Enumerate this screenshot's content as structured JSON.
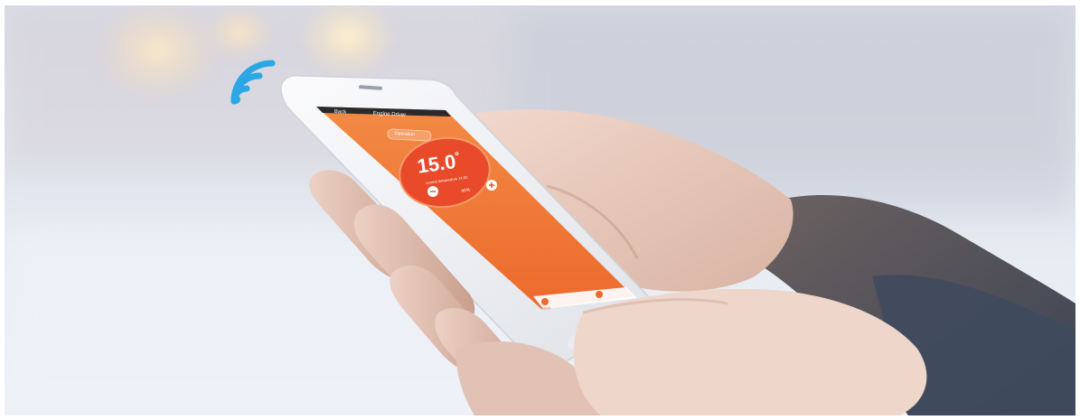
{
  "phone": {
    "app_header": {
      "back_label": "Back",
      "title": "Engine Driver"
    },
    "thermostat": {
      "mode_pill": "Operation",
      "temperature": "15.0",
      "degree_mark": "°",
      "sublabel": "current temperature 14.0C",
      "humidity": "40%"
    },
    "bottom_nav": {
      "left_label": "Heat",
      "right_label": ""
    }
  },
  "colors": {
    "wifi_icon": "#2aa7e4",
    "screen_orange": "#f07a3a",
    "dial_red": "#e94a2a",
    "sky_top": "#d9dde8",
    "sleeve": "#4a5567"
  }
}
